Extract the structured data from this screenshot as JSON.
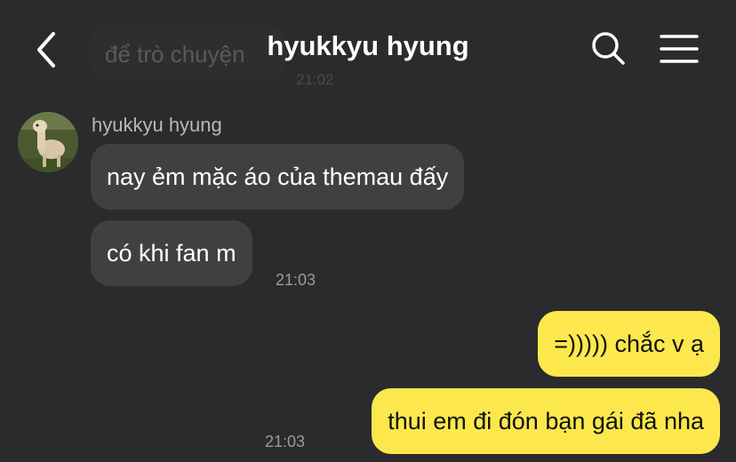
{
  "header": {
    "title": "hyukkyu hyung",
    "back_icon": "chevron-left-icon",
    "search_icon": "search-icon",
    "menu_icon": "hamburger-menu-icon"
  },
  "previous": {
    "text": "để trò chuyện",
    "time": "21:02"
  },
  "incoming": {
    "sender": "hyukkyu hyung",
    "messages": [
      "nay ẻm mặc áo của themau đấy",
      "có khi fan m"
    ],
    "time": "21:03"
  },
  "outgoing": {
    "messages": [
      "=))))) chắc v ạ",
      "thui em đi đón bạn gái đã nha"
    ],
    "time": "21:03"
  },
  "colors": {
    "background": "#2b2b2d",
    "incoming_bubble": "#404042",
    "outgoing_bubble": "#fce84d"
  }
}
